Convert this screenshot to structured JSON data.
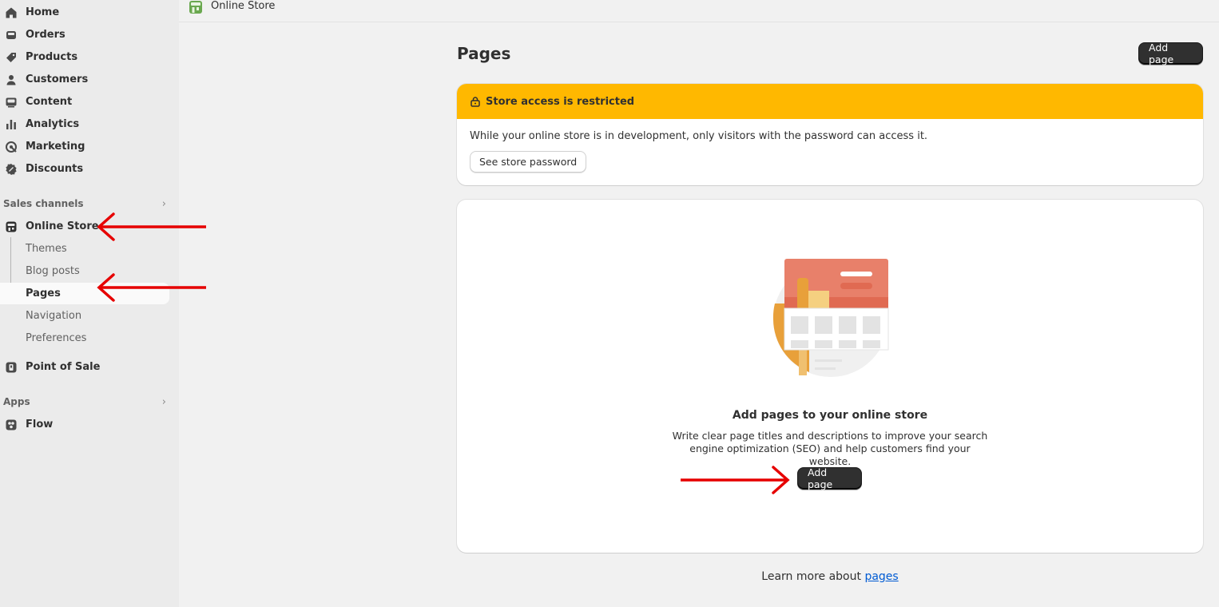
{
  "sidebar": {
    "main_items": [
      {
        "label": "Home",
        "icon": "home-icon"
      },
      {
        "label": "Orders",
        "icon": "inbox-icon"
      },
      {
        "label": "Products",
        "icon": "tag-icon"
      },
      {
        "label": "Customers",
        "icon": "person-icon"
      },
      {
        "label": "Content",
        "icon": "image-icon"
      },
      {
        "label": "Analytics",
        "icon": "bar-chart-icon"
      },
      {
        "label": "Marketing",
        "icon": "target-icon"
      },
      {
        "label": "Discounts",
        "icon": "discount-icon"
      }
    ],
    "sales_channels_label": "Sales channels",
    "online_store_label": "Online Store",
    "online_store_subitems": [
      "Themes",
      "Blog posts",
      "Pages",
      "Navigation",
      "Preferences"
    ],
    "active_subitem": "Pages",
    "pos_label": "Point of Sale",
    "apps_label": "Apps",
    "flow_label": "Flow",
    "chevron": "›"
  },
  "topbar": {
    "title": "Online Store"
  },
  "main": {
    "page_title": "Pages",
    "add_page_label": "Add page",
    "banner": {
      "title": "Store access is restricted",
      "message": "While your online store is in development, only visitors with the password can access it.",
      "button_label": "See store password",
      "color": "#ffb800"
    },
    "empty_state": {
      "title": "Add pages to your online store",
      "description": "Write clear page titles and descriptions to improve your search engine optimization (SEO) and help customers find your website.",
      "button_label": "Add page"
    },
    "learn_more_text": "Learn more about ",
    "learn_more_link": "pages"
  },
  "annotations": {
    "arrow_color": "#e60000"
  }
}
